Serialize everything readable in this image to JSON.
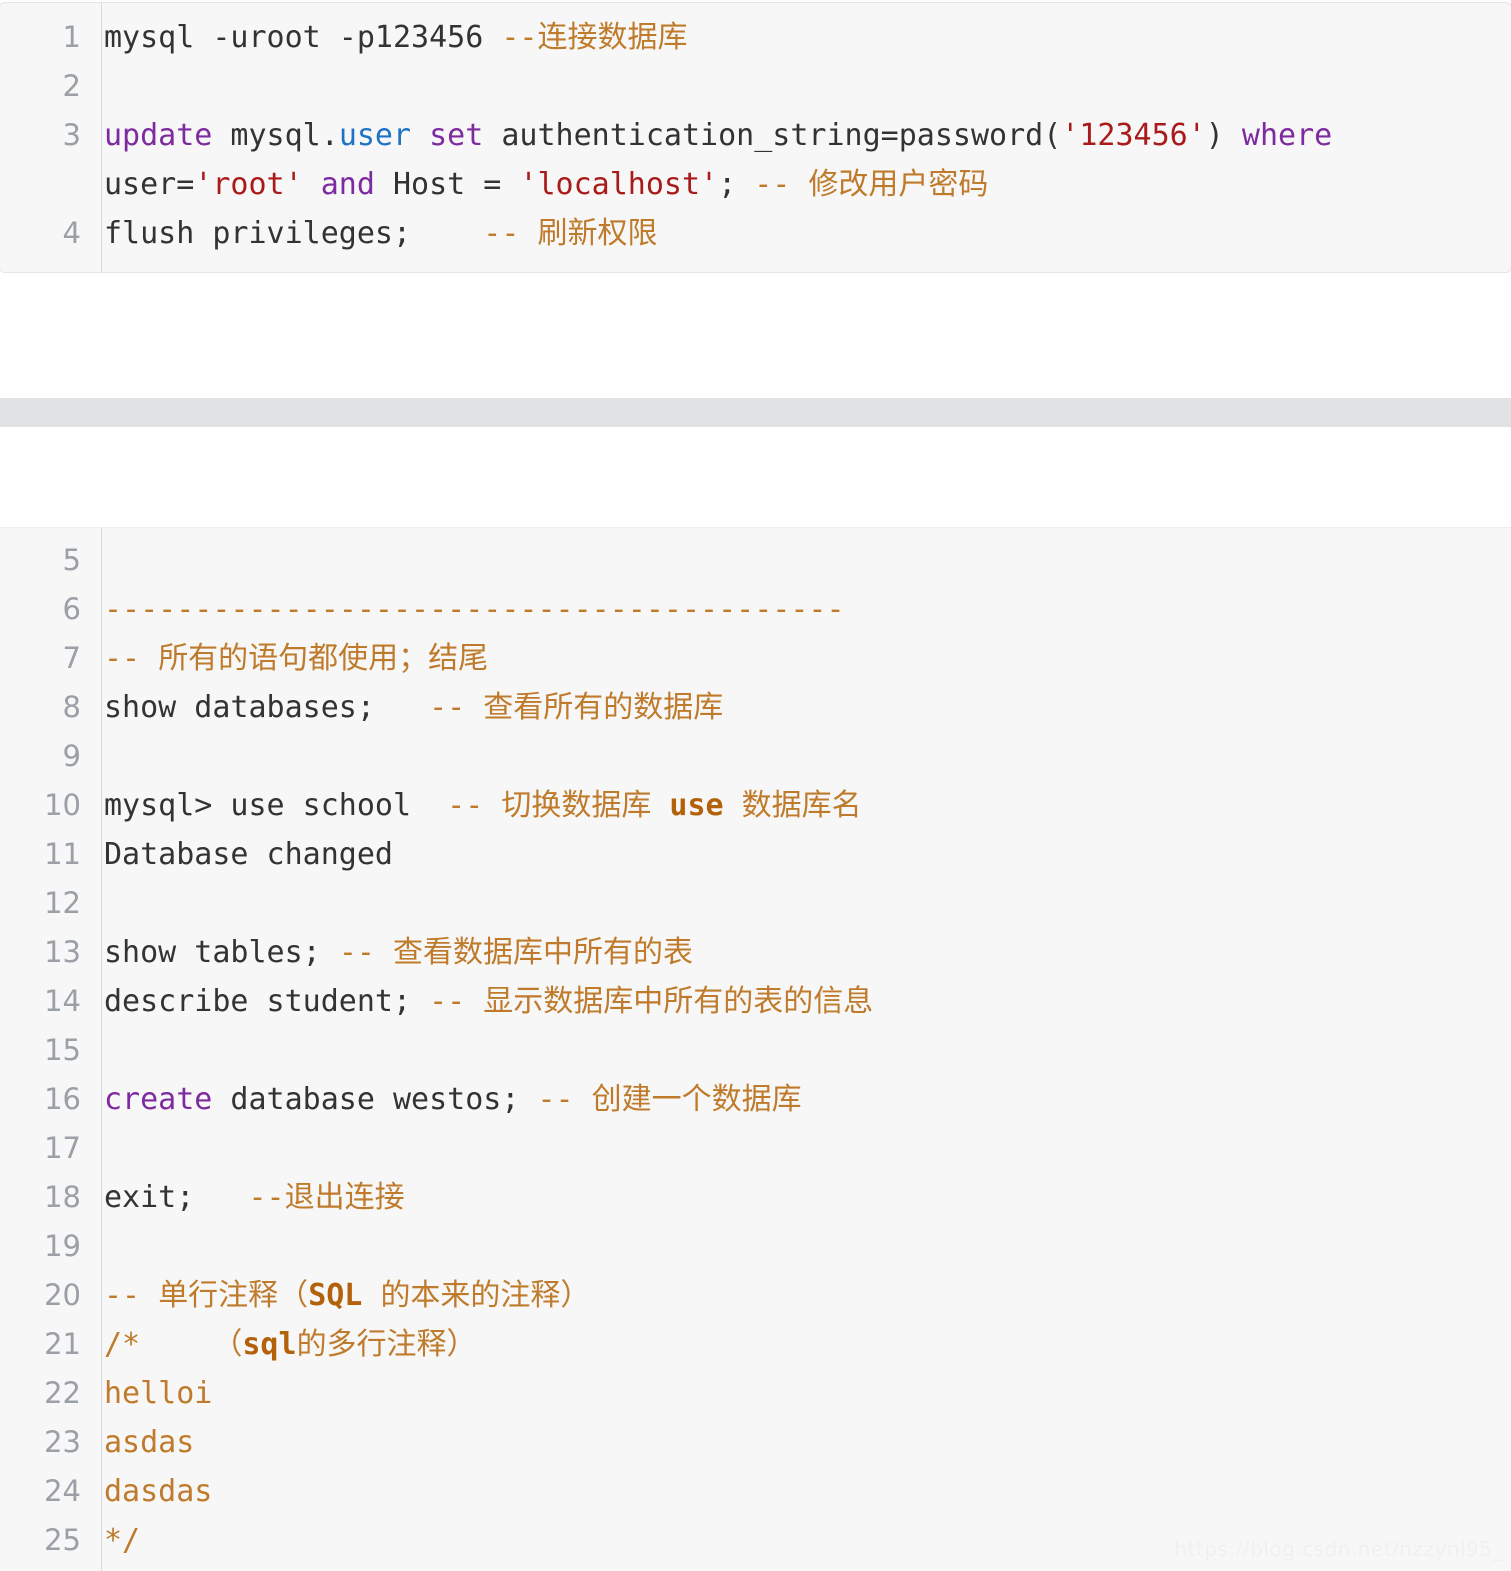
{
  "page": {
    "watermark": "https://blog.csdn.net/nzzynl95_",
    "background_color": "#ffffff",
    "code_background": "#f7f7f7",
    "border_color": "#e3e5e8",
    "separator_color": "#e1e2e4",
    "gutter_rule_color": "#d6d9dc",
    "lineno_color": "#9aa0a6"
  },
  "colors": {
    "keyword": "#7e2aa0",
    "identifier": "#1f73c4",
    "string": "#a91b1b",
    "comment": "#bf7b2b",
    "comment_strong": "#b3620b",
    "plain": "#333333"
  },
  "blocks": [
    {
      "name": "mysql-connect-and-password-block",
      "language": "sql",
      "first_line": 1,
      "lines": [
        {
          "number": "1",
          "text": "mysql -uroot -p123456 --连接数据库",
          "tokens": [
            {
              "t": "mysql -uroot -p123456 ",
              "c": "plain"
            },
            {
              "t": "--连接数据库",
              "c": "cmt"
            }
          ]
        },
        {
          "number": "2",
          "text": "",
          "tokens": []
        },
        {
          "number": "3",
          "text": "update mysql.user set authentication_string=password('123456') where user='root' and Host = 'localhost'; -- 修改用户密码",
          "tokens": [
            {
              "t": "update",
              "c": "kw"
            },
            {
              "t": " mysql.",
              "c": "plain"
            },
            {
              "t": "user",
              "c": "fn"
            },
            {
              "t": " ",
              "c": "plain"
            },
            {
              "t": "set",
              "c": "kw"
            },
            {
              "t": " authentication_string=password(",
              "c": "plain"
            },
            {
              "t": "'123456'",
              "c": "str"
            },
            {
              "t": ") ",
              "c": "plain"
            },
            {
              "t": "where",
              "c": "kw"
            },
            {
              "t": " user=",
              "c": "plain"
            },
            {
              "t": "'root'",
              "c": "str"
            },
            {
              "t": " ",
              "c": "plain"
            },
            {
              "t": "and",
              "c": "kw"
            },
            {
              "t": " Host = ",
              "c": "plain"
            },
            {
              "t": "'localhost'",
              "c": "str"
            },
            {
              "t": "; ",
              "c": "plain"
            },
            {
              "t": "-- 修改用户密码",
              "c": "cmt"
            }
          ]
        },
        {
          "number": "4",
          "text": "flush privileges;    -- 刷新权限",
          "tokens": [
            {
              "t": "flush privileges;   ",
              "c": "plain"
            },
            {
              "t": " -- 刷新权限",
              "c": "cmt"
            }
          ]
        }
      ]
    },
    {
      "name": "sql-basics-block",
      "language": "sql",
      "first_line": 5,
      "lines": [
        {
          "number": "5",
          "text": "",
          "tokens": []
        },
        {
          "number": "6",
          "text": "-----------------------------------------",
          "tokens": [
            {
              "t": "-----------------------------------------",
              "c": "cmt"
            }
          ]
        },
        {
          "number": "7",
          "text": "-- 所有的语句都使用；结尾",
          "tokens": [
            {
              "t": "-- 所有的语句都使用；结尾",
              "c": "cmt"
            }
          ]
        },
        {
          "number": "8",
          "text": "show databases;   -- 查看所有的数据库",
          "tokens": [
            {
              "t": "show databases;  ",
              "c": "plain"
            },
            {
              "t": " -- 查看所有的数据库",
              "c": "cmt"
            }
          ]
        },
        {
          "number": "9",
          "text": "",
          "tokens": []
        },
        {
          "number": "10",
          "text": "mysql> use school  -- 切换数据库 use 数据库名",
          "tokens": [
            {
              "t": "mysql> use school ",
              "c": "plain"
            },
            {
              "t": " -- 切换数据库 ",
              "c": "cmt"
            },
            {
              "t": "use",
              "c": "cmt-strong"
            },
            {
              "t": " 数据库名",
              "c": "cmt"
            }
          ]
        },
        {
          "number": "11",
          "text": "Database changed",
          "tokens": [
            {
              "t": "Database changed",
              "c": "plain"
            }
          ]
        },
        {
          "number": "12",
          "text": "",
          "tokens": []
        },
        {
          "number": "13",
          "text": "show tables; -- 查看数据库中所有的表",
          "tokens": [
            {
              "t": "show tables; ",
              "c": "plain"
            },
            {
              "t": "-- 查看数据库中所有的表",
              "c": "cmt"
            }
          ]
        },
        {
          "number": "14",
          "text": "describe student; -- 显示数据库中所有的表的信息",
          "tokens": [
            {
              "t": "describe student; ",
              "c": "plain"
            },
            {
              "t": "-- 显示数据库中所有的表的信息",
              "c": "cmt"
            }
          ]
        },
        {
          "number": "15",
          "text": "",
          "tokens": []
        },
        {
          "number": "16",
          "text": "create database westos; -- 创建一个数据库",
          "tokens": [
            {
              "t": "create",
              "c": "kw"
            },
            {
              "t": " database westos; ",
              "c": "plain"
            },
            {
              "t": "-- 创建一个数据库",
              "c": "cmt"
            }
          ]
        },
        {
          "number": "17",
          "text": "",
          "tokens": []
        },
        {
          "number": "18",
          "text": "exit;   --退出连接",
          "tokens": [
            {
              "t": "exit;  ",
              "c": "plain"
            },
            {
              "t": " --退出连接",
              "c": "cmt"
            }
          ]
        },
        {
          "number": "19",
          "text": "",
          "tokens": []
        },
        {
          "number": "20",
          "text": "-- 单行注释（SQL 的本来的注释）",
          "tokens": [
            {
              "t": "-- 单行注释（",
              "c": "cmt"
            },
            {
              "t": "SQL",
              "c": "cmt-strong"
            },
            {
              "t": " 的本来的注释）",
              "c": "cmt"
            }
          ]
        },
        {
          "number": "21",
          "text": "/*    （sql的多行注释）",
          "tokens": [
            {
              "t": "/*    （",
              "c": "cmt"
            },
            {
              "t": "sql",
              "c": "cmt-strong"
            },
            {
              "t": "的多行注释）",
              "c": "cmt"
            }
          ]
        },
        {
          "number": "22",
          "text": "helloi",
          "tokens": [
            {
              "t": "helloi",
              "c": "cmt"
            }
          ]
        },
        {
          "number": "23",
          "text": "asdas",
          "tokens": [
            {
              "t": "asdas",
              "c": "cmt"
            }
          ]
        },
        {
          "number": "24",
          "text": "dasdas",
          "tokens": [
            {
              "t": "dasdas",
              "c": "cmt"
            }
          ]
        },
        {
          "number": "25",
          "text": "*/",
          "tokens": [
            {
              "t": "*/",
              "c": "cmt"
            }
          ]
        }
      ]
    }
  ]
}
